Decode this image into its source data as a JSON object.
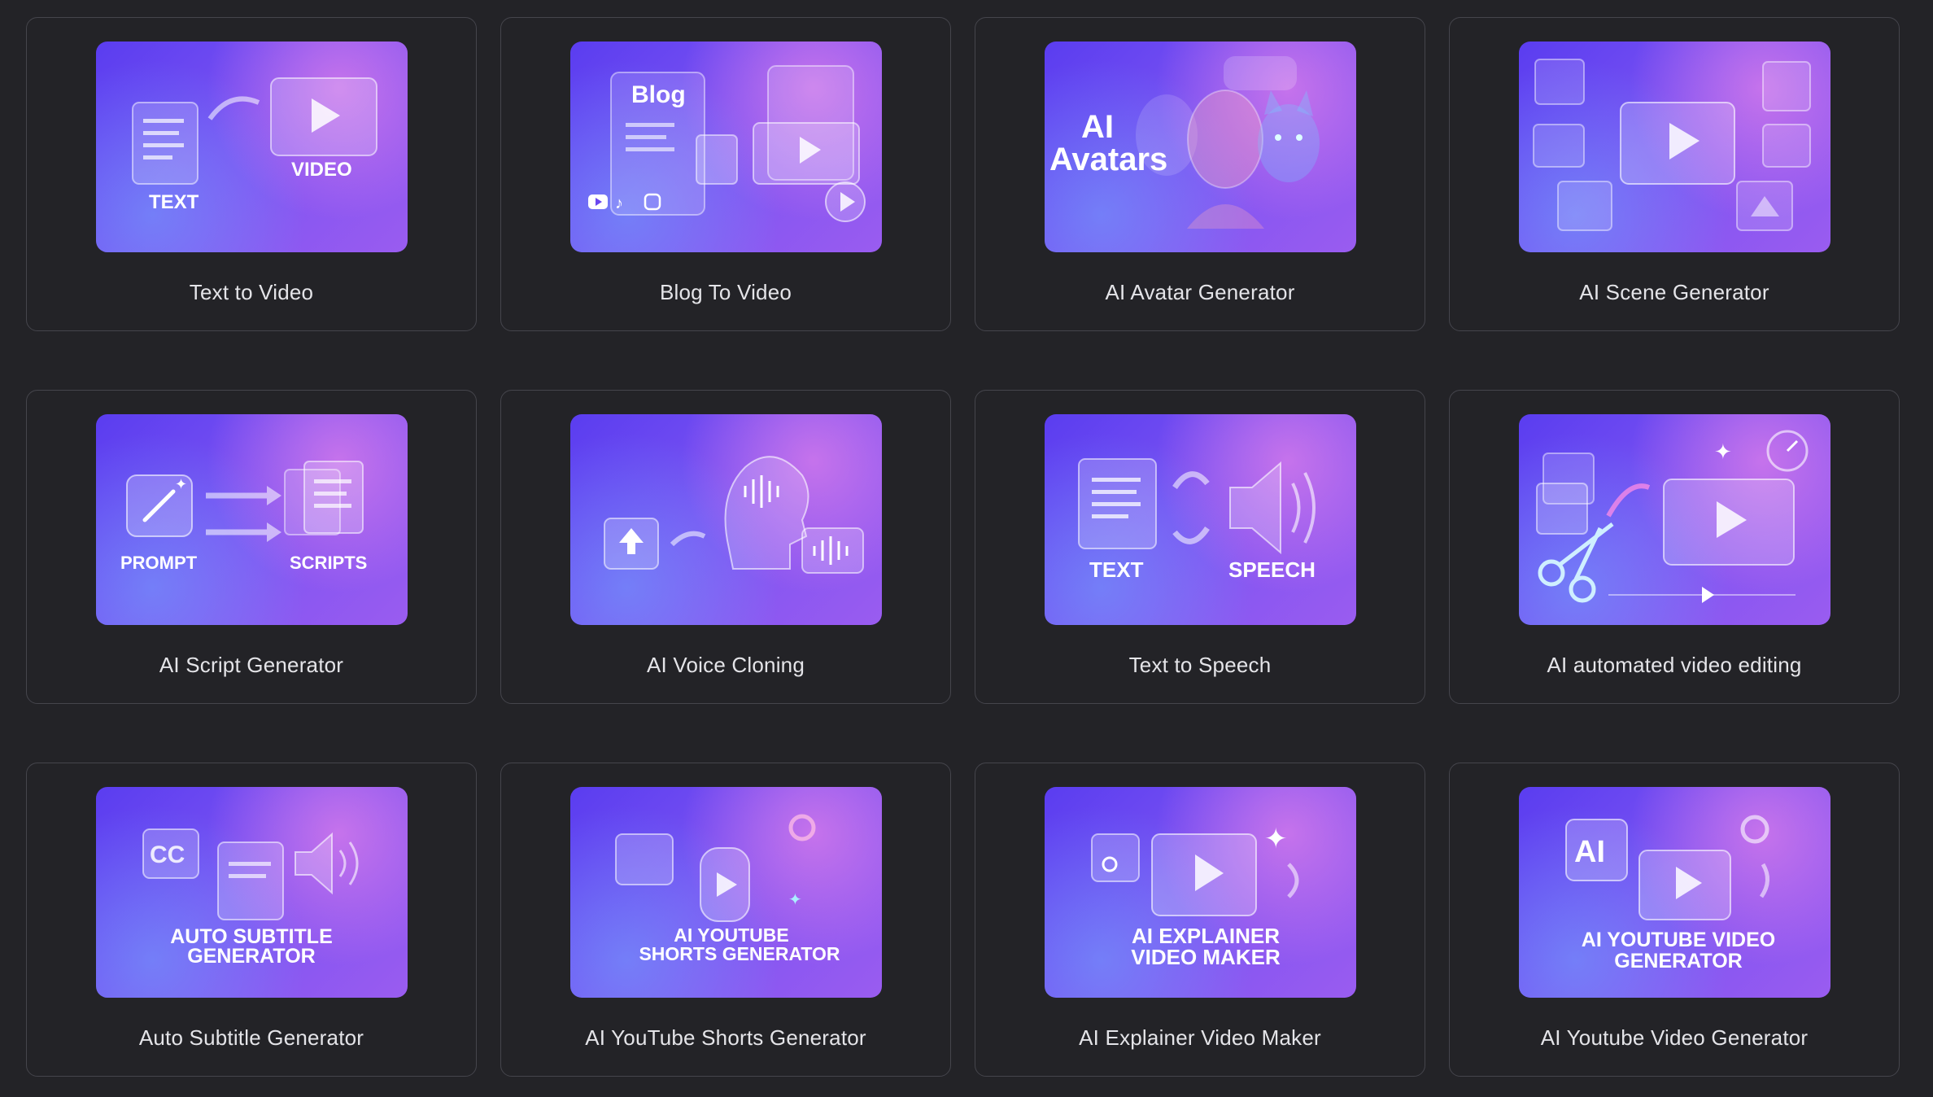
{
  "tools": [
    {
      "title": "Text to Video",
      "art": [
        "TEXT",
        "VIDEO"
      ]
    },
    {
      "title": "Blog To Video",
      "art": [
        "Blog"
      ]
    },
    {
      "title": "AI Avatar Generator",
      "art": [
        "AI",
        "Avatars"
      ]
    },
    {
      "title": "AI Scene Generator",
      "art": []
    },
    {
      "title": "AI Script Generator",
      "art": [
        "PROMPT",
        "SCRIPTS"
      ]
    },
    {
      "title": "AI Voice Cloning",
      "art": []
    },
    {
      "title": "Text to Speech",
      "art": [
        "TEXT",
        "SPEECH"
      ]
    },
    {
      "title": "AI automated video editing",
      "art": []
    },
    {
      "title": "Auto Subtitle Generator",
      "art": [
        "CC",
        "AUTO SUBTITLE",
        "GENERATOR"
      ]
    },
    {
      "title": "AI YouTube Shorts Generator",
      "art": [
        "AI YOUTUBE",
        "SHORTS GENERATOR"
      ]
    },
    {
      "title": "AI Explainer Video Maker",
      "art": [
        "AI EXPLAINER",
        "VIDEO MAKER"
      ]
    },
    {
      "title": "AI Youtube Video Generator",
      "art": [
        "AI",
        "AI YOUTUBE VIDEO",
        "GENERATOR"
      ]
    }
  ],
  "icons": {
    "social": [
      "youtube-icon",
      "tiktok-icon",
      "instagram-icon"
    ]
  }
}
